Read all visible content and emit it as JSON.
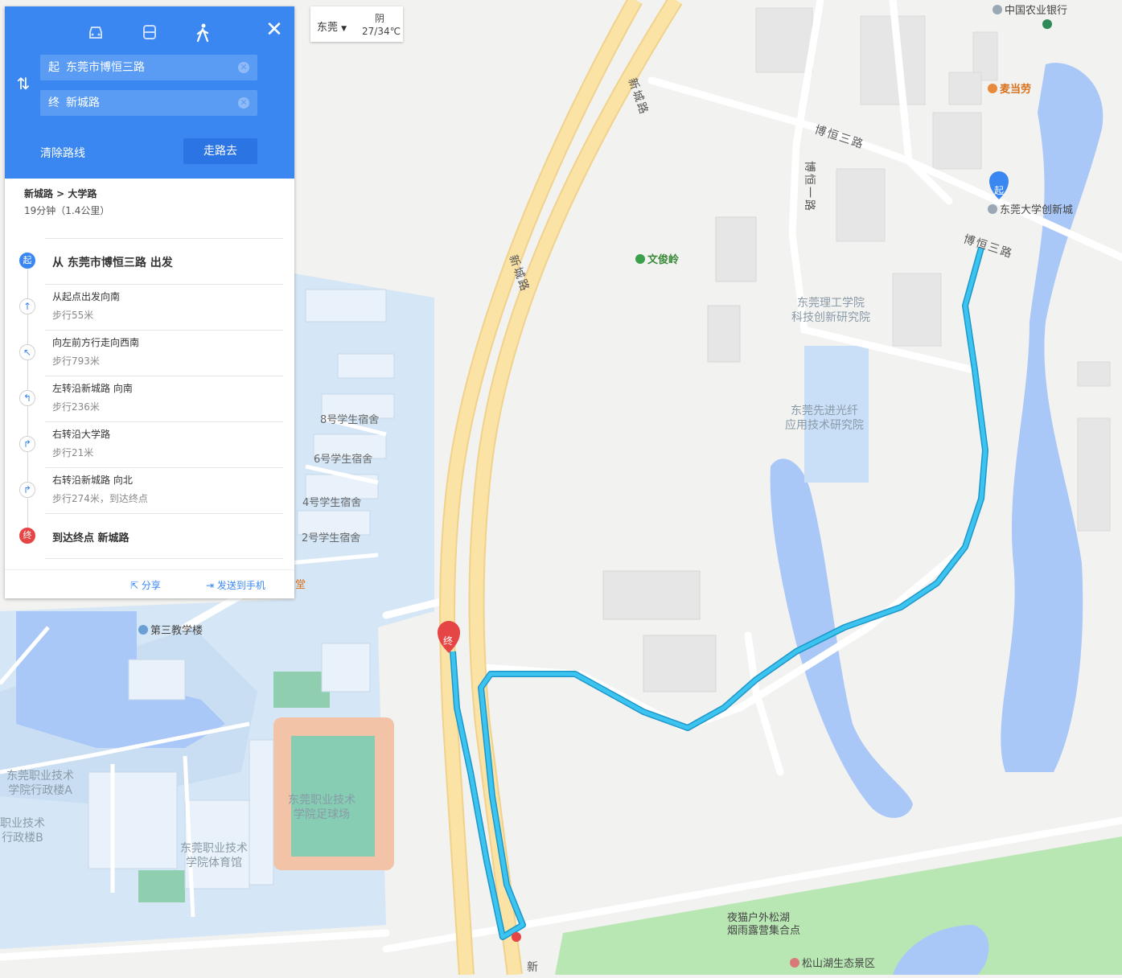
{
  "panel": {
    "modes": [
      {
        "name": "car",
        "active": false
      },
      {
        "name": "bus",
        "active": false
      },
      {
        "name": "walk",
        "active": true
      }
    ],
    "start_tag": "起",
    "start_value": "东莞市博恒三路",
    "end_tag": "终",
    "end_value": "新城路",
    "clear_label": "清除路线",
    "go_label": "走路去",
    "summary_route": "新城路 > 大学路",
    "summary_time": "19分钟（1.4公里）",
    "steps": [
      {
        "icon": "start",
        "main": "从 东莞市博恒三路 出发",
        "sub": ""
      },
      {
        "icon": "straight",
        "main": "从起点出发向南",
        "sub": "步行55米"
      },
      {
        "icon": "bear-left",
        "main": "向左前方行走向西南",
        "sub": "步行793米"
      },
      {
        "icon": "turn-left",
        "main": "左转沿新城路 向南",
        "sub": "步行236米"
      },
      {
        "icon": "turn-right",
        "main": "右转沿大学路",
        "sub": "步行21米"
      },
      {
        "icon": "turn-right",
        "main": "右转沿新城路 向北",
        "sub": "步行274米，到达终点"
      },
      {
        "icon": "end",
        "main": "到达终点 新城路",
        "sub": ""
      }
    ],
    "share_label": "分享",
    "send_label": "发送到手机"
  },
  "city": {
    "name": "东莞",
    "weather": "阴",
    "temp": "27/34℃"
  },
  "map": {
    "labels": {
      "xinchenglu_top": "新城路",
      "xinchenglu_mid": "新城路",
      "xin_bottom": "新",
      "boheng3_top": "博恒三路",
      "boheng1": "博恒一路",
      "boheng3_right": "博恒三路",
      "wenjunling": "文俊岭",
      "mcdonalds": "麦当劳",
      "abc_bank": "中国农业银行",
      "dgu": "东莞大学创新城",
      "dgut_line1": "东莞理工学院",
      "dgut_line2": "科技创新研究院",
      "photonics_line1": "东莞先进光纤",
      "photonics_line2": "应用技术研究院",
      "dorm8": "8号学生宿舍",
      "dorm6": "6号学生宿舍",
      "dorm4": "4号学生宿舍",
      "dorm2": "2号学生宿舍",
      "teaching3": "第三教学楼",
      "admin_a_1": "东莞职业技术",
      "admin_a_2": "学院行政楼A",
      "admin_b_1": "职业技术",
      "admin_b_2": "行政楼B",
      "gym_1": "东莞职业技术",
      "gym_2": "学院体育馆",
      "field_1": "东莞职业技术",
      "field_2": "学院足球场",
      "camp_1": "夜猫户外松湖",
      "camp_2": "烟雨露营集合点",
      "songshan": "松山湖生态景区",
      "hall": "堂",
      "start_marker": "起",
      "end_marker": "终"
    },
    "colors": {
      "route": "#2bb0e4",
      "water": "#a9c7f7",
      "campus": "#d5e7f6",
      "green": "#b9e7b4",
      "road_yellow": "#fbe3a6"
    }
  }
}
